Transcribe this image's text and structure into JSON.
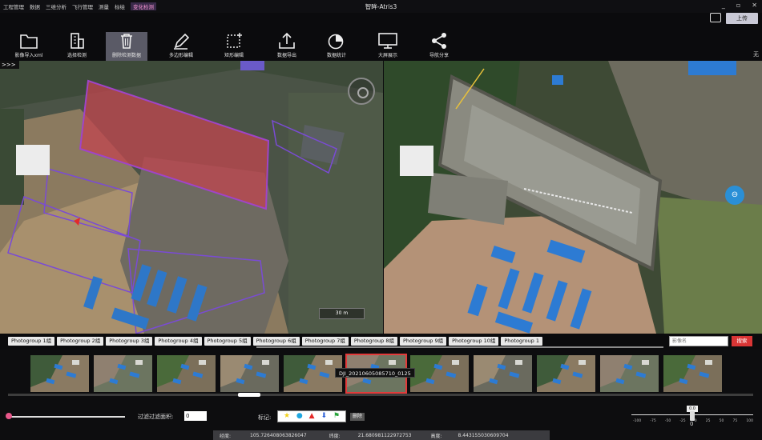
{
  "window": {
    "title": "智眸-Atris3",
    "menu": [
      "工程管理",
      "数据",
      "三维分析",
      "飞行管理",
      "测量",
      "标绘",
      "变化检测"
    ],
    "active_menu": "变化检测",
    "controls": [
      "_",
      "▫",
      "✕"
    ],
    "upload_label": "上传"
  },
  "toolbar": {
    "tools": [
      {
        "label": "影像导入xml",
        "icon": "folder-icon"
      },
      {
        "label": "选择检测",
        "icon": "building-icon"
      },
      {
        "label": "删除检测数据",
        "icon": "trash-icon"
      },
      {
        "label": "多边形编辑",
        "icon": "pen-icon"
      },
      {
        "label": "矩形编辑",
        "icon": "rect-edit-icon"
      },
      {
        "label": "数据导出",
        "icon": "export-icon"
      },
      {
        "label": "数据统计",
        "icon": "pie-chart-icon"
      },
      {
        "label": "大屏展示",
        "icon": "monitor-icon"
      },
      {
        "label": "导航分享",
        "icon": "share-icon"
      }
    ],
    "right_label": "无"
  },
  "viewer": {
    "expand_label": ">>>",
    "scale_label": "30 m"
  },
  "photogroups": {
    "tabs": [
      "Photogroup 1组",
      "Photogroup 2组",
      "Photogroup 3组",
      "Photogroup 4组",
      "Photogroup 5组",
      "Photogroup 6组",
      "Photogroup 7组",
      "Photogroup 8组",
      "Photogroup 9组",
      "Photogroup 10组",
      "Photogroup 1"
    ],
    "search_placeholder": "影像名",
    "search_button": "搜索"
  },
  "thumbnails": {
    "count": 11,
    "selected_index": 5,
    "tooltip": "DJI_20210605085710_0125"
  },
  "controls": {
    "filter_label": "过滤过滤面积:",
    "filter_value": "0",
    "mark_label": "标记:",
    "mark_icons": [
      "star-icon",
      "circle-icon",
      "triangle-icon",
      "arrow-down-icon",
      "flag-icon"
    ],
    "mark_delete": "删除",
    "zoom_value": "0.0",
    "zoom_zero": "0",
    "zoom_ticks": [
      "-100",
      "-75",
      "-50",
      "-25",
      "0",
      "25",
      "50",
      "75",
      "100"
    ]
  },
  "status": {
    "lon_label": "经度:",
    "lon_value": "105.726408063826047",
    "lat_label": "纬度:",
    "lat_value": "21.680981122972753",
    "height_label": "高度:",
    "height_value": "8.443155030609704"
  }
}
